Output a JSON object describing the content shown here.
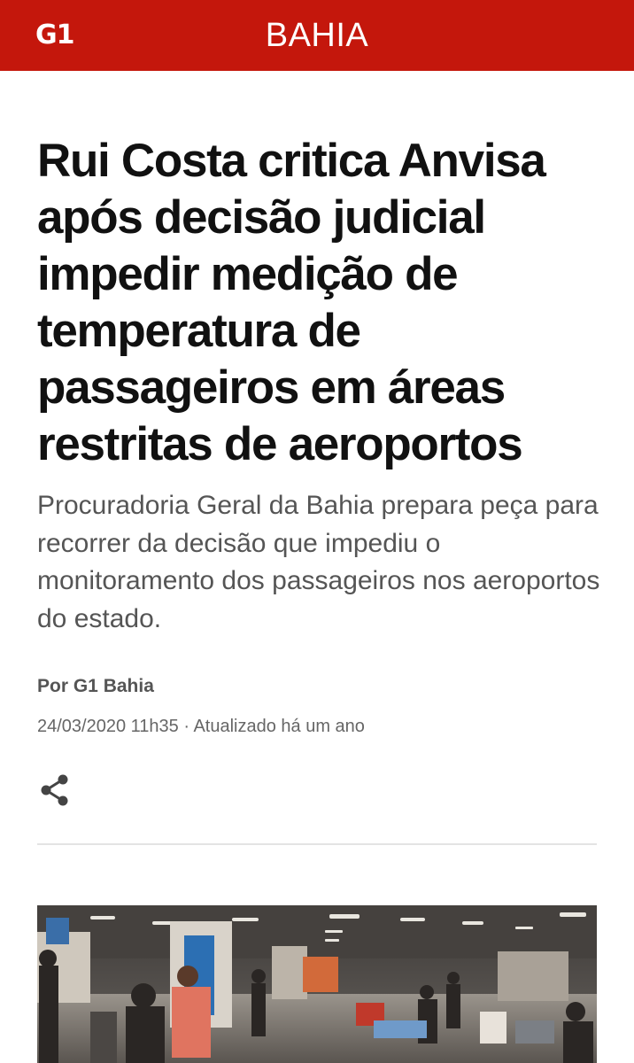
{
  "header": {
    "logo": "G1",
    "section": "BAHIA",
    "brand_color": "#c4170c"
  },
  "article": {
    "title": "Rui Costa critica Anvisa após decisão judicial impedir medição de temperatura de passageiros em áreas restritas de aeroportos",
    "subtitle": "Procuradoria Geral da Bahia prepara peça para recorrer da decisão que impediu o monitoramento dos passageiros nos aeroportos do estado.",
    "author": "Por G1 Bahia",
    "dates": "24/03/2020 11h35 · Atualizado há um ano",
    "share_icon": "share-icon",
    "photo_icon": "airport-photo"
  }
}
